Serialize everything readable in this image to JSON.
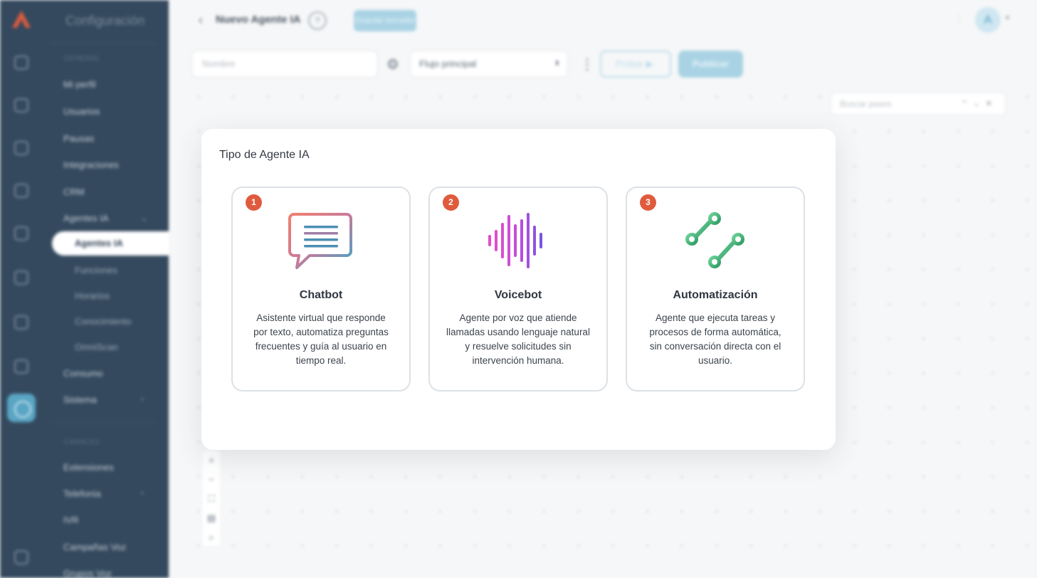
{
  "app": {
    "panel_title": "Configuración",
    "section_general": "GENERAL",
    "section_channels": "CANALES",
    "nav": {
      "mi_perfil": "Mi perfil",
      "usuarios": "Usuarios",
      "pausas": "Pausas",
      "integraciones": "Integraciones",
      "crm": "CRM",
      "agentes_ia": "Agentes IA",
      "sub_agentes_ia": "Agentes IA",
      "funciones": "Funciones",
      "horarios": "Horarios",
      "conocimiento": "Conocimiento",
      "omniscan": "OmniScan",
      "consumo": "Consumo",
      "sistema": "Sistema",
      "extensiones": "Extensiones",
      "telefonia": "Telefonía",
      "ivr": "IVR",
      "campanas_voz": "Campañas Voz",
      "grupos_voz": "Grupos Voz"
    }
  },
  "header": {
    "back_icon": "chevron-left-icon",
    "title": "Nuevo Agente IA",
    "help": "?",
    "save_draft": "Guardar borrador",
    "avatar_initial": "A"
  },
  "toolbar": {
    "name_placeholder": "Nombre",
    "flow_selected": "Flujo principal",
    "test_label": "Probar",
    "publish_label": "Publicar"
  },
  "canvas": {
    "search_placeholder": "Buscar pasos",
    "zoom_in": "+",
    "zoom_out": "−"
  },
  "modal": {
    "title": "Tipo de Agente IA",
    "cards": [
      {
        "number": "1",
        "title": "Chatbot",
        "description": "Asistente virtual que responde por texto, automatiza preguntas frecuentes y guía al usuario en tiempo real.",
        "icon": "chat-bubble-icon"
      },
      {
        "number": "2",
        "title": "Voicebot",
        "description": "Agente por voz que atiende llamadas usando lenguaje natural y resuelve solicitudes sin intervención humana.",
        "icon": "sound-wave-icon"
      },
      {
        "number": "3",
        "title": "Automatización",
        "description": "Agente que ejecuta tareas y procesos de forma automática, sin conversación directa con el usuario.",
        "icon": "workflow-nodes-icon"
      }
    ]
  }
}
